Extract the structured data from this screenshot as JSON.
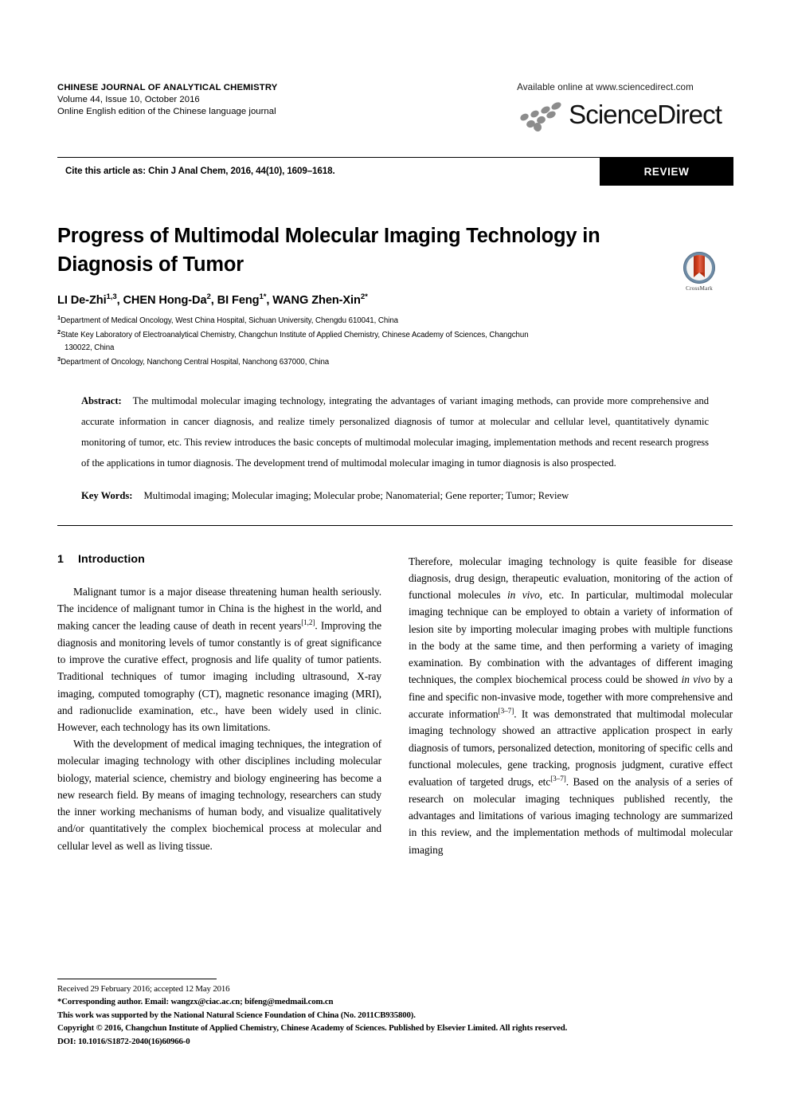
{
  "masthead": {
    "journal_title": "CHINESE JOURNAL OF ANALYTICAL CHEMISTRY",
    "volume_line": "Volume 44, Issue 10, October 2016",
    "edition_line": "Online English edition of the Chinese language journal",
    "available_online": "Available online at www.sciencedirect.com",
    "logo_word_science": "Science",
    "logo_word_direct": "Direct"
  },
  "cite": {
    "text": "Cite this article as: Chin J Anal Chem, 2016, 44(10), 1609–1618.",
    "badge": "REVIEW"
  },
  "article": {
    "title": "Progress of Multimodal Molecular Imaging Technology in Diagnosis of Tumor",
    "crossmark_label": "CrossMark",
    "authors_html": "LI De-Zhi<sup>1,3</sup>, CHEN Hong-Da<sup>2</sup>, BI Feng<sup>1*</sup>, WANG Zhen-Xin<sup>2*</sup>",
    "affiliations": [
      {
        "marker": "1",
        "text": "Department of Medical Oncology, West China Hospital, Sichuan University, Chengdu 610041, China",
        "continuation": ""
      },
      {
        "marker": "2",
        "text": "State Key Laboratory of Electroanalytical Chemistry, Changchun Institute of Applied Chemistry, Chinese Academy of Sciences, Changchun",
        "continuation": "130022, China"
      },
      {
        "marker": "3",
        "text": "Department of Oncology, Nanchong Central Hospital, Nanchong 637000, China",
        "continuation": ""
      }
    ]
  },
  "abstract": {
    "label": "Abstract:",
    "text": "The multimodal molecular imaging technology, integrating the advantages of variant imaging methods, can provide more comprehensive and accurate information in cancer diagnosis, and realize timely personalized diagnosis of tumor at molecular and cellular level, quantitatively dynamic monitoring of tumor, etc. This review introduces the basic concepts of multimodal molecular imaging, implementation methods and recent research progress of the applications in tumor diagnosis. The development trend of multimodal molecular imaging in tumor diagnosis is also prospected.",
    "keywords_label": "Key Words:",
    "keywords_text": "Multimodal imaging; Molecular imaging; Molecular probe; Nanomaterial; Gene reporter; Tumor; Review"
  },
  "body": {
    "section_number": "1",
    "section_title": "Introduction",
    "left_paragraphs": [
      "Malignant tumor is a major disease threatening human health seriously. The incidence of malignant tumor in China is the highest in the world, and making cancer the leading cause of death in recent years<sup>[1,2]</sup>. Improving the diagnosis and monitoring levels of tumor constantly is of great significance to improve the curative effect, prognosis and life quality of tumor patients. Traditional techniques of tumor imaging including ultrasound, X-ray imaging, computed tomography (CT), magnetic resonance imaging (MRI), and radionuclide examination, etc., have been widely used in clinic. However, each technology has its own limitations.",
      "With the development of medical imaging techniques, the integration of molecular imaging technology with other disciplines including molecular biology, material science, chemistry and biology engineering has become a new research field. By means of imaging technology, researchers can study the inner working mechanisms of human body, and visualize qualitatively and/or quantitatively the complex biochemical process at molecular and cellular level as well as living tissue."
    ],
    "right_paragraphs": [
      "Therefore, molecular imaging technology is quite feasible for disease diagnosis, drug design, therapeutic evaluation, monitoring of the action of functional molecules <i>in vivo</i>, etc. In particular, multimodal molecular imaging technique can be employed to obtain a variety of information of lesion site by importing molecular imaging probes with multiple functions in the body at the same time, and then performing a variety of imaging examination. By combination with the advantages of different imaging techniques, the complex biochemical process could be showed <i>in vivo</i> by a fine and specific non-invasive mode, together with more comprehensive and accurate information<sup>[3–7]</sup>. It was demonstrated that multimodal molecular imaging technology showed an attractive application prospect in early diagnosis of tumors, personalized detection, monitoring of specific cells and functional molecules, gene tracking, prognosis judgment, curative effect evaluation of targeted drugs, etc<sup>[3–7]</sup>. Based on the analysis of a series of research on molecular imaging techniques published recently, the advantages and limitations of various imaging technology are summarized in this review, and the implementation methods of multimodal molecular imaging"
    ]
  },
  "footnotes": {
    "received": "Received 29 February 2016; accepted 12 May 2016",
    "corresponding": "*Corresponding author. Email: wangzx@ciac.ac.cn; bifeng@medmail.com.cn",
    "funding": "This work was supported by the National Natural Science Foundation of China (No. 2011CB935800).",
    "copyright": "Copyright © 2016, Changchun Institute of Applied Chemistry, Chinese Academy of Sciences. Published by Elsevier Limited. All rights reserved.",
    "doi": "DOI: 10.1016/S1872-2040(16)60966-0"
  },
  "colors": {
    "text": "#000000",
    "badge_bg": "#000000",
    "badge_fg": "#ffffff",
    "logo_gray": "#8c8c8c",
    "crossmark_ring": "#6f8ca6",
    "crossmark_ribbon": "#c1330f"
  }
}
